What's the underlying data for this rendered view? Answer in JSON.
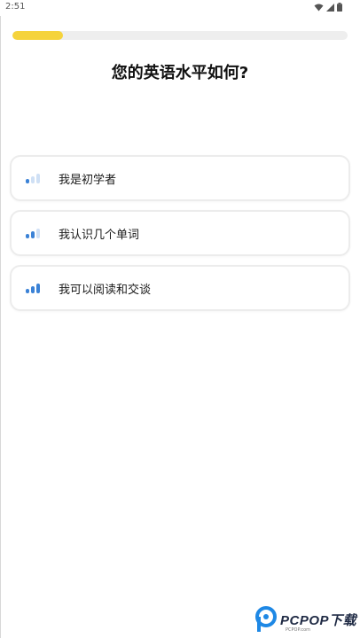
{
  "status_bar": {
    "time": "2:51",
    "icons": [
      "wifi-icon",
      "signal-icon",
      "battery-icon"
    ]
  },
  "progress": {
    "fraction": 0.15,
    "color": "#f5d33c"
  },
  "question": "您的英语水平如何?",
  "options": [
    {
      "label": "我是初学者",
      "icon": "level-1-bars-icon",
      "bars_active": 1
    },
    {
      "label": "我认识几个单词",
      "icon": "level-2-bars-icon",
      "bars_active": 2
    },
    {
      "label": "我可以阅读和交谈",
      "icon": "level-3-bars-icon",
      "bars_active": 3
    }
  ],
  "colors": {
    "bar_active": "#3b82d6",
    "bar_inactive": "#cfe0f5",
    "card_border": "#ececec"
  },
  "watermark": {
    "text": "PCPOP下载",
    "sub": "PCPOP.com"
  }
}
